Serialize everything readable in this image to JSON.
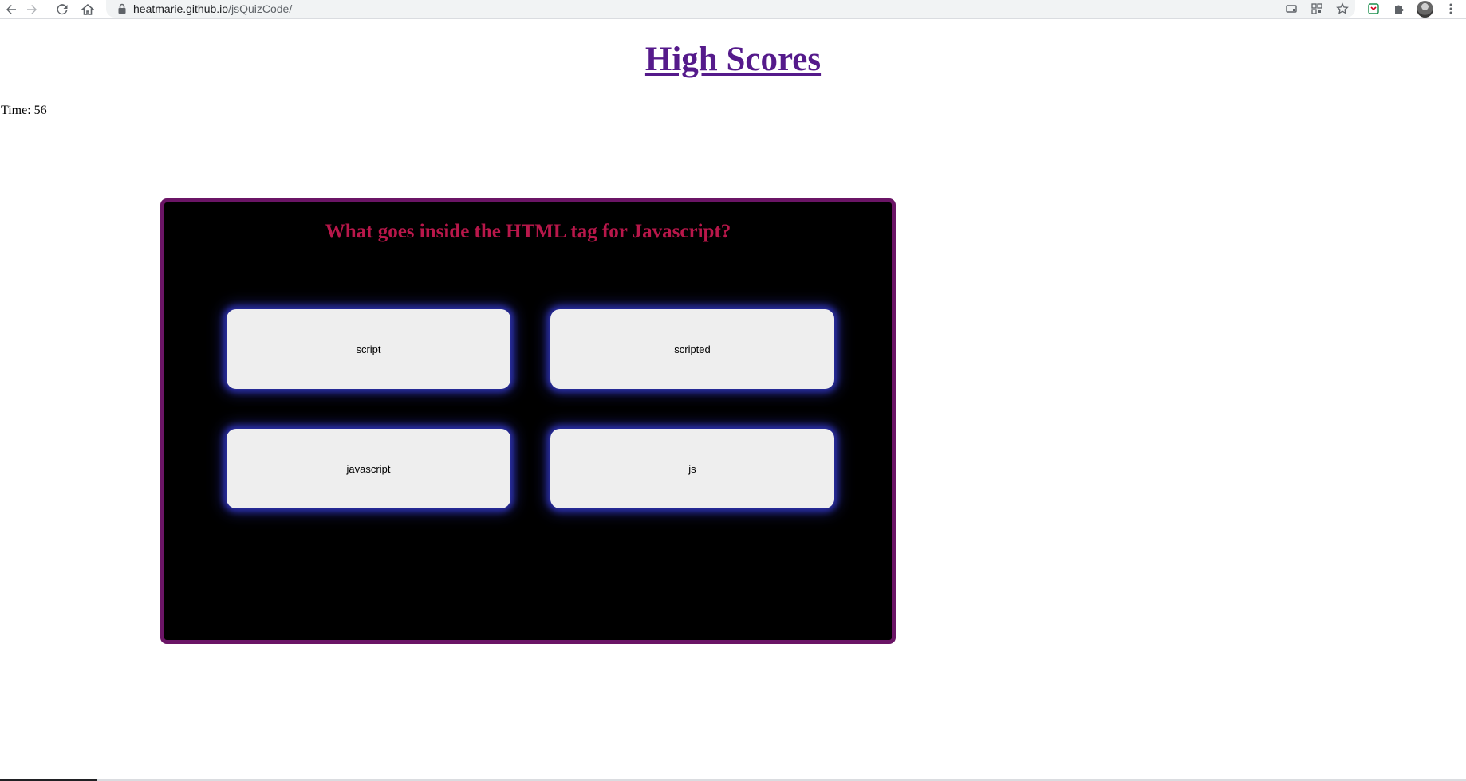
{
  "browser": {
    "url_host": "heatmarie.github.io",
    "url_path": "/jsQuizCode/"
  },
  "page": {
    "title_link": "High Scores",
    "timer_text": "Time: 56"
  },
  "quiz": {
    "question": "What goes inside the HTML tag for Javascript?",
    "answers": [
      "script",
      "scripted",
      "javascript",
      "js"
    ]
  },
  "colors": {
    "card_border": "#6b1566",
    "question_text": "#b8174a",
    "answer_glow": "#2b2fa8",
    "link_visited": "#551a8b"
  },
  "icons": [
    "back-icon",
    "forward-icon",
    "reload-icon",
    "home-icon",
    "lock-icon",
    "cast-icon",
    "qr-icon",
    "star-icon",
    "extension-pocket-icon",
    "puzzle-icon",
    "menu-dots-icon"
  ]
}
